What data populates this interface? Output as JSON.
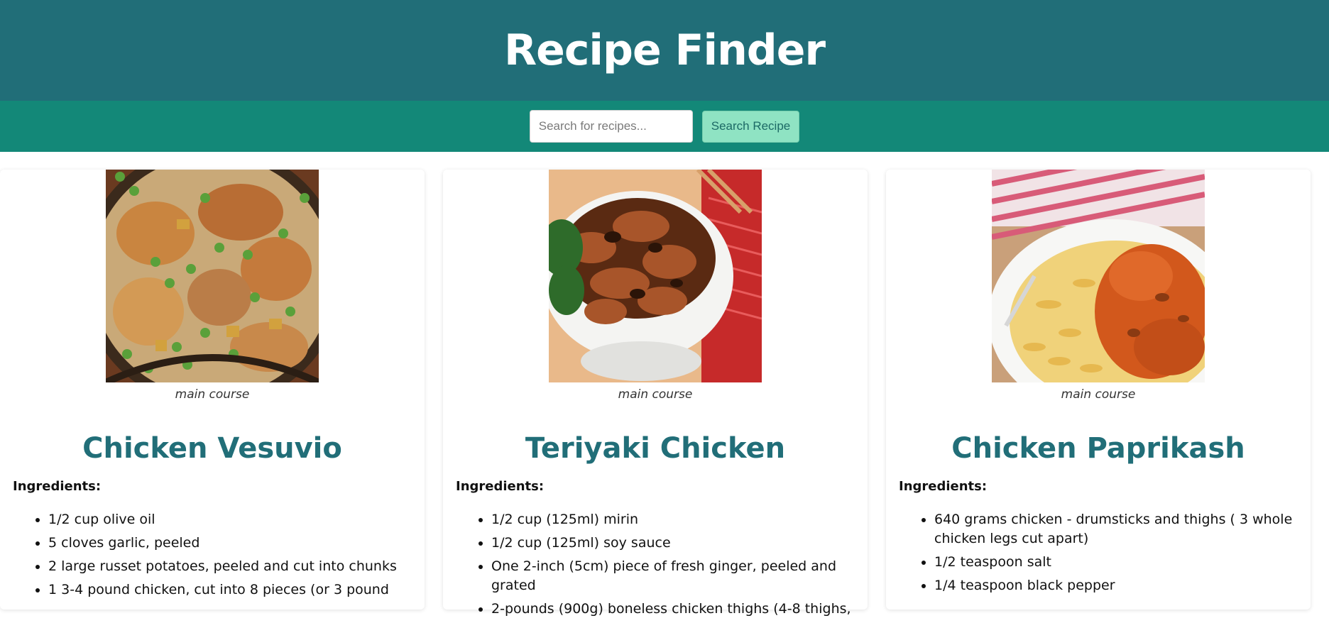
{
  "header": {
    "title": "Recipe Finder"
  },
  "search": {
    "placeholder": "Search for recipes...",
    "button_label": "Search Recipe"
  },
  "colors": {
    "header_bg": "#216e78",
    "searchbar_bg": "#138878",
    "button_bg": "#8fe3c3",
    "title_color": "#216e78"
  },
  "recipes": [
    {
      "image": "chicken-vesuvio-photo",
      "category": "main course",
      "title": "Chicken Vesuvio",
      "ingredients_label": "Ingredients:",
      "ingredients": [
        "1/2 cup olive oil",
        "5 cloves garlic, peeled",
        "2 large russet potatoes, peeled and cut into chunks",
        "1 3-4 pound chicken, cut into 8 pieces (or 3 pound"
      ]
    },
    {
      "image": "teriyaki-chicken-photo",
      "category": "main course",
      "title": "Teriyaki Chicken",
      "ingredients_label": "Ingredients:",
      "ingredients": [
        "1/2 cup (125ml) mirin",
        "1/2 cup (125ml) soy sauce",
        "One 2-inch (5cm) piece of fresh ginger, peeled and grated",
        "2-pounds (900g) boneless chicken thighs (4-8 thighs,"
      ]
    },
    {
      "image": "chicken-paprikash-photo",
      "category": "main course",
      "title": "Chicken Paprikash",
      "ingredients_label": "Ingredients:",
      "ingredients": [
        "640 grams chicken - drumsticks and thighs ( 3 whole chicken legs cut apart)",
        "1/2 teaspoon salt",
        "1/4 teaspoon black pepper"
      ]
    }
  ]
}
